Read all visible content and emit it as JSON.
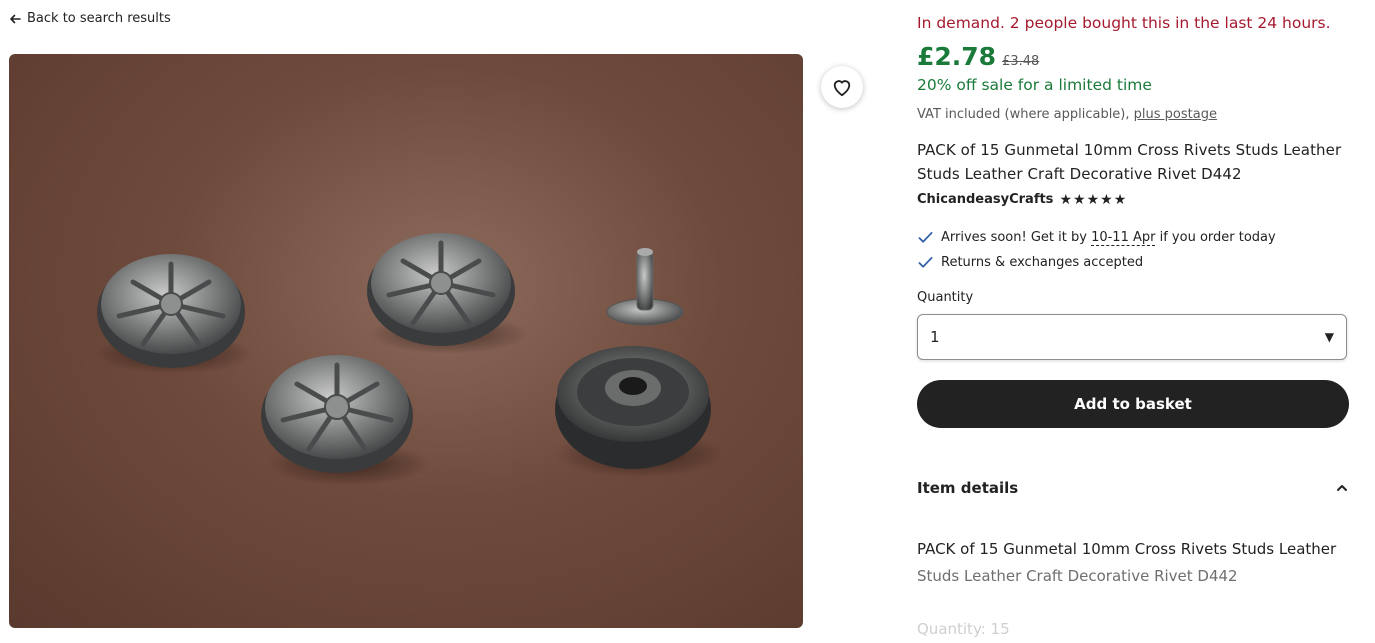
{
  "nav": {
    "back_label": "Back to search results"
  },
  "listing": {
    "demand_text": "In demand. 2 people bought this in the last 24 hours.",
    "price": "£2.78",
    "original_price": "£3.48",
    "sale_text": "20% off sale for a limited time",
    "vat_prefix": "VAT included (where applicable),",
    "vat_link": "plus postage",
    "title": "PACK of 15 Gunmetal 10mm Cross Rivets Studs Leather Studs Leather Craft Decorative Rivet D442",
    "shop_name": "ChicandeasyCrafts",
    "rating_stars": 5,
    "arrival_prefix": "Arrives soon! Get it by",
    "arrival_date": "10-11 Apr",
    "arrival_suffix": "if you order today",
    "returns_text": "Returns & exchanges accepted"
  },
  "purchase": {
    "quantity_label": "Quantity",
    "quantity_value": "1",
    "add_button": "Add to basket"
  },
  "details": {
    "heading": "Item details",
    "line1": "PACK of 15 Gunmetal 10mm Cross Rivets Studs Leather",
    "line2": "Studs Leather Craft Decorative Rivet D442",
    "line3": "Quantity: 15"
  },
  "colors": {
    "demand_red": "#a61a2e",
    "price_green": "#1a7a3a",
    "button_dark": "#222222",
    "check_blue": "#2f5ea8"
  },
  "icons": [
    "arrow-left-icon",
    "heart-icon",
    "star-icon",
    "check-icon",
    "chevron-down-icon",
    "chevron-up-icon"
  ]
}
